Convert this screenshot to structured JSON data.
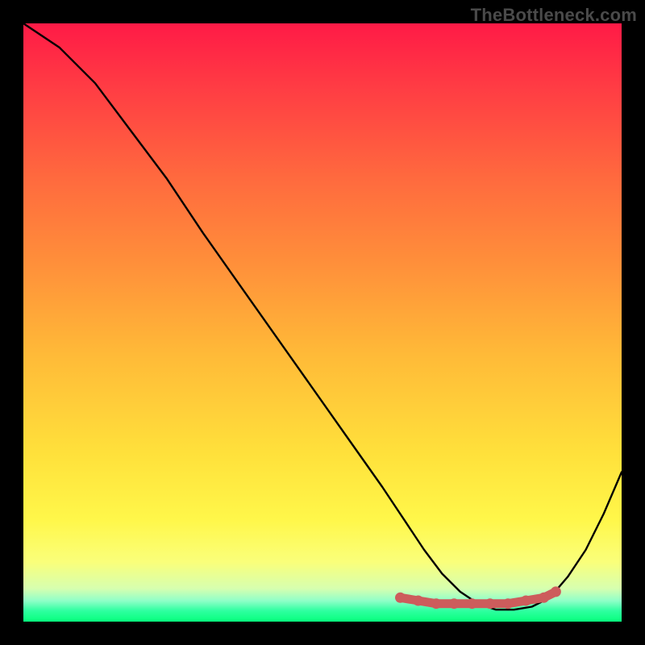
{
  "attribution": "TheBottleneck.com",
  "chart_data": {
    "type": "line",
    "title": "",
    "xlabel": "",
    "ylabel": "",
    "xlim": [
      0,
      100
    ],
    "ylim": [
      0,
      100
    ],
    "series": [
      {
        "name": "black-curve",
        "x": [
          0,
          6,
          12,
          18,
          24,
          30,
          36,
          42,
          48,
          54,
          60,
          64,
          67,
          70,
          73,
          76,
          79,
          82,
          85,
          88,
          91,
          94,
          97,
          100
        ],
        "y": [
          100,
          96,
          90,
          82,
          74,
          65,
          56.5,
          48,
          39.5,
          31,
          22.5,
          16.5,
          12,
          8,
          5,
          3,
          2,
          2,
          2.5,
          4,
          7.5,
          12,
          18,
          25
        ]
      },
      {
        "name": "pink-floor-markers",
        "x": [
          63,
          66,
          69,
          72,
          75,
          78,
          81,
          84,
          87,
          89
        ],
        "y": [
          4,
          3.5,
          3,
          3,
          3,
          3,
          3,
          3.5,
          4,
          5
        ]
      }
    ],
    "background": {
      "type": "vertical-gradient",
      "stops": [
        {
          "pos": 0.0,
          "color": "#ff1a46"
        },
        {
          "pos": 0.26,
          "color": "#ff6a3e"
        },
        {
          "pos": 0.55,
          "color": "#ffb938"
        },
        {
          "pos": 0.83,
          "color": "#fff74a"
        },
        {
          "pos": 0.95,
          "color": "#d6ffb0"
        },
        {
          "pos": 1.0,
          "color": "#06ff7c"
        }
      ]
    }
  }
}
